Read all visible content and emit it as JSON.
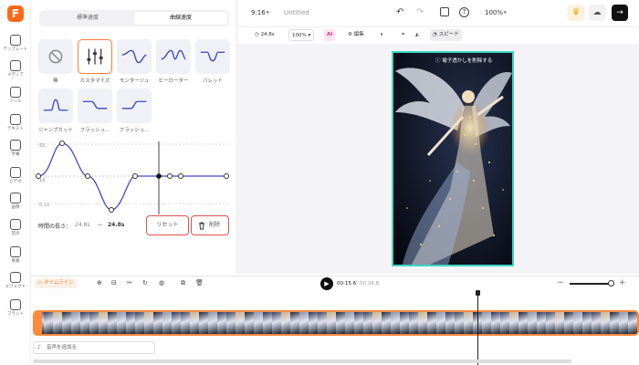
{
  "app": {
    "logo_letter": "F",
    "aspect": "9:16",
    "title": "Untitled",
    "zoom": "100%",
    "accent": "#ff6a1a",
    "teal": "#3dd6c4"
  },
  "rail": [
    {
      "label": "テンプレート",
      "icon": "template-icon"
    },
    {
      "label": "メディア",
      "icon": "media-icon"
    },
    {
      "label": "ツール",
      "icon": "ai-tools-icon"
    },
    {
      "label": "テキスト",
      "icon": "text-icon"
    },
    {
      "label": "字幕",
      "icon": "subtitle-icon"
    },
    {
      "label": "ビデオ",
      "icon": "video-icon"
    },
    {
      "label": "画像",
      "icon": "image-icon"
    },
    {
      "label": "音声",
      "icon": "audio-icon"
    },
    {
      "label": "要素",
      "icon": "elements-icon"
    },
    {
      "label": "エフェクト",
      "icon": "effects-icon"
    },
    {
      "label": "ブランド",
      "icon": "brand-icon"
    }
  ],
  "panel": {
    "tabs": [
      "標準速度",
      "曲線速度"
    ],
    "presets": [
      "無",
      "カスタマイズ",
      "モンタージュ",
      "ヒーローター",
      "バレット",
      "ジャンプカット",
      "フラッシュ...",
      "フラッシュ..."
    ],
    "chart_labels": [
      "5X",
      "1X",
      "0.1X"
    ],
    "duration_label": "時間の長さ：",
    "duration_from": "24.8s",
    "arrow": "→",
    "duration_to": "24.8s",
    "reset": "リセット",
    "delete": "削除"
  },
  "toolbar": {
    "duration": "24.8s",
    "zoom": "100%",
    "edit": "編集",
    "speed": "スピード",
    "ai": "AI"
  },
  "video": {
    "watermark": "電子透かしを削除する"
  },
  "timeline": {
    "label": "タイムライン",
    "current": "00:15.6",
    "total": "00:34.8",
    "sep": "/",
    "add_audio": "音声を追加る"
  }
}
